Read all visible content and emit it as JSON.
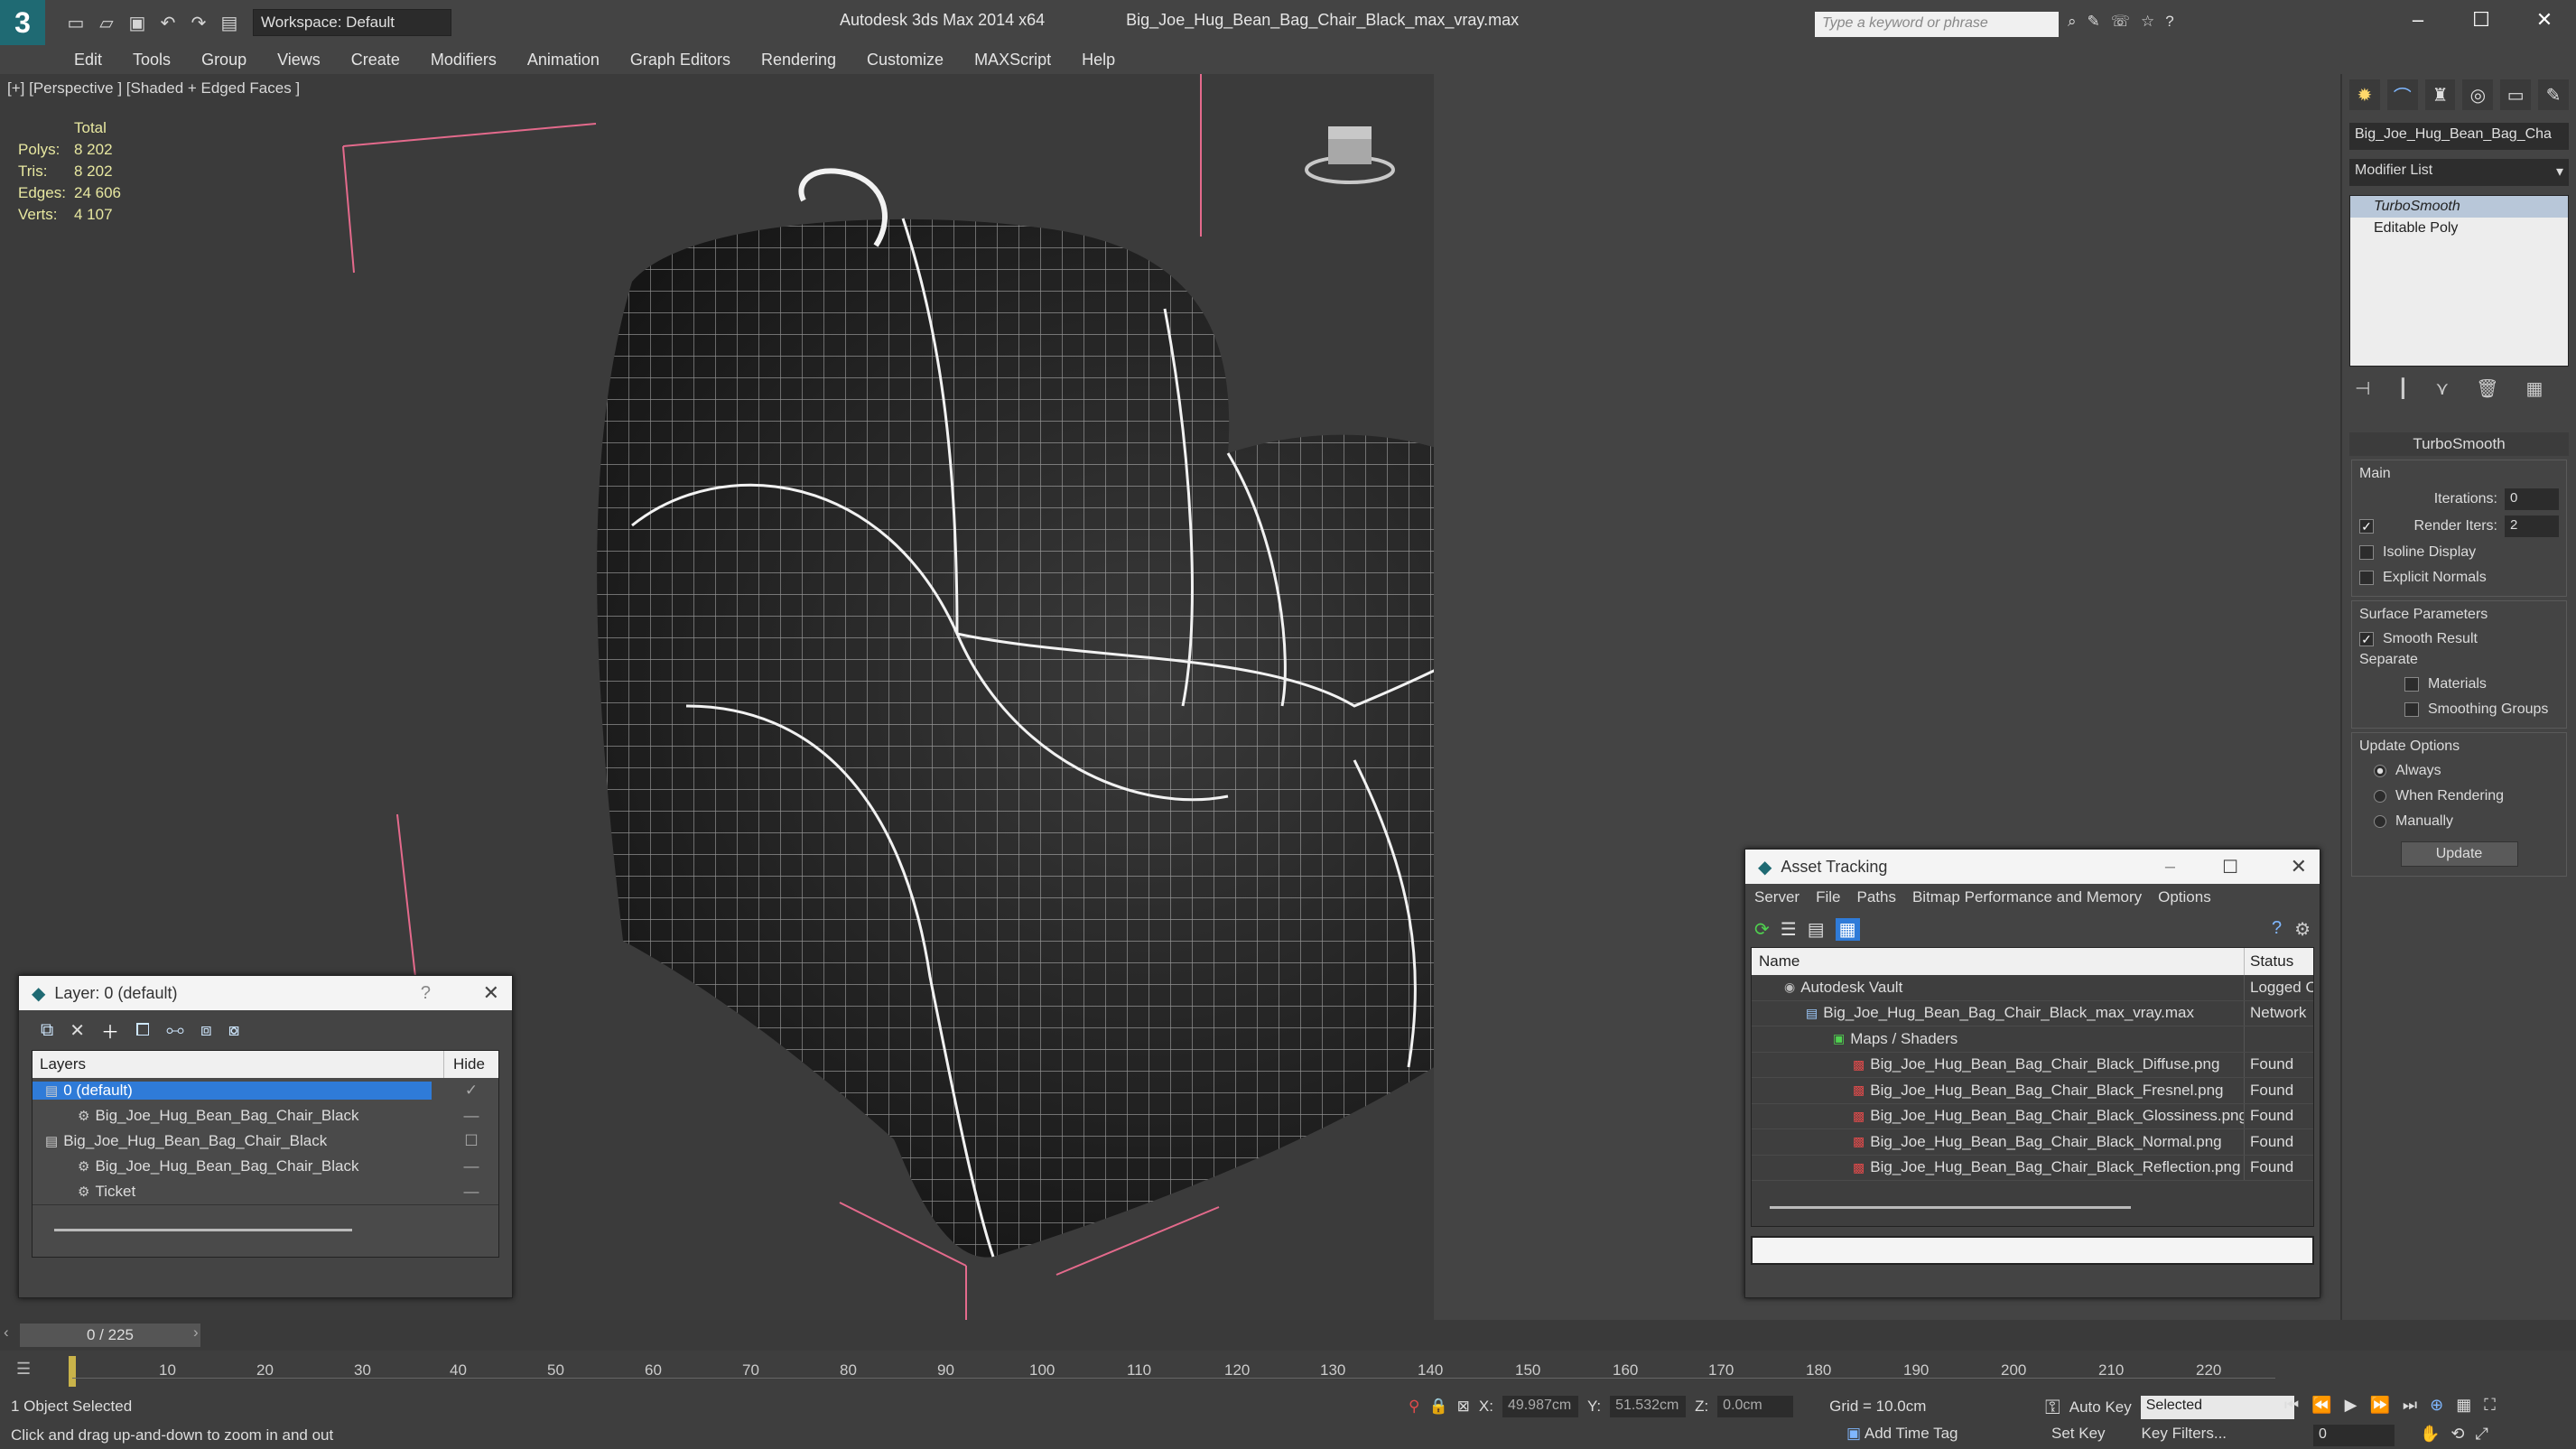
{
  "titlebar": {
    "app": "Autodesk 3ds Max  2014 x64",
    "file": "Big_Joe_Hug_Bean_Bag_Chair_Black_max_vray.max",
    "workspace": "Workspace: Default",
    "search_placeholder": "Type a keyword or phrase"
  },
  "menu": [
    "Edit",
    "Tools",
    "Group",
    "Views",
    "Create",
    "Modifiers",
    "Animation",
    "Graph Editors",
    "Rendering",
    "Customize",
    "MAXScript",
    "Help"
  ],
  "viewport": {
    "label": "[+] [Perspective ] [Shaded + Edged Faces ]",
    "stats": {
      "total_label": "Total",
      "rows": [
        {
          "k": "Polys:",
          "v": "8 202"
        },
        {
          "k": "Tris:",
          "v": "8 202"
        },
        {
          "k": "Edges:",
          "v": "24 606"
        },
        {
          "k": "Verts:",
          "v": "4 107"
        }
      ]
    }
  },
  "command_panel": {
    "object_name": "Big_Joe_Hug_Bean_Bag_Cha",
    "modifier_list": "Modifier List",
    "stack": [
      "TurboSmooth",
      "Editable Poly"
    ],
    "rollout": "TurboSmooth",
    "main_label": "Main",
    "iterations_label": "Iterations:",
    "iterations": "0",
    "render_iters_label": "Render Iters:",
    "render_iters": "2",
    "isoline": "Isoline Display",
    "explicit_normals": "Explicit Normals",
    "surface_label": "Surface Parameters",
    "smooth_result": "Smooth Result",
    "separate_label": "Separate",
    "materials": "Materials",
    "smoothing_groups": "Smoothing Groups",
    "update_options_label": "Update Options",
    "always": "Always",
    "when_rendering": "When Rendering",
    "manually": "Manually",
    "update_btn": "Update"
  },
  "layer_panel": {
    "title": "Layer: 0 (default)",
    "col_layers": "Layers",
    "col_hide": "Hide",
    "rows": [
      {
        "name": "0 (default)",
        "indent": 0,
        "selected": true
      },
      {
        "name": "Big_Joe_Hug_Bean_Bag_Chair_Black",
        "indent": 1,
        "selected": false
      },
      {
        "name": "Big_Joe_Hug_Bean_Bag_Chair_Black",
        "indent": 0,
        "selected": false
      },
      {
        "name": "Big_Joe_Hug_Bean_Bag_Chair_Black",
        "indent": 1,
        "selected": false
      },
      {
        "name": "Ticket",
        "indent": 1,
        "selected": false
      }
    ]
  },
  "asset_panel": {
    "title": "Asset Tracking",
    "menu": [
      "Server",
      "File",
      "Paths",
      "Bitmap Performance and Memory",
      "Options"
    ],
    "col_name": "Name",
    "col_status": "Status",
    "rows": [
      {
        "name": "Autodesk Vault",
        "status": "Logged O",
        "indent": 1,
        "icon": "vault"
      },
      {
        "name": "Big_Joe_Hug_Bean_Bag_Chair_Black_max_vray.max",
        "status": "Network",
        "indent": 2,
        "icon": "file"
      },
      {
        "name": "Maps / Shaders",
        "status": "",
        "indent": 3,
        "icon": "folder"
      },
      {
        "name": "Big_Joe_Hug_Bean_Bag_Chair_Black_Diffuse.png",
        "status": "Found",
        "indent": 4,
        "icon": "png"
      },
      {
        "name": "Big_Joe_Hug_Bean_Bag_Chair_Black_Fresnel.png",
        "status": "Found",
        "indent": 4,
        "icon": "png"
      },
      {
        "name": "Big_Joe_Hug_Bean_Bag_Chair_Black_Glossiness.png",
        "status": "Found",
        "indent": 4,
        "icon": "png"
      },
      {
        "name": "Big_Joe_Hug_Bean_Bag_Chair_Black_Normal.png",
        "status": "Found",
        "indent": 4,
        "icon": "png"
      },
      {
        "name": "Big_Joe_Hug_Bean_Bag_Chair_Black_Reflection.png",
        "status": "Found",
        "indent": 4,
        "icon": "png"
      }
    ]
  },
  "timeline": {
    "frame": "0 / 225",
    "ticks": [
      "10",
      "20",
      "30",
      "40",
      "50",
      "60",
      "70",
      "80",
      "90",
      "100",
      "110",
      "120",
      "130",
      "140",
      "150",
      "160",
      "170",
      "180",
      "190",
      "200",
      "210",
      "220"
    ]
  },
  "status": {
    "selected": "1 Object Selected",
    "prompt": "Click and drag up-and-down to zoom in and out",
    "x": "49.987cm",
    "y": "51.532cm",
    "z": "0.0cm",
    "grid": "Grid = 10.0cm",
    "auto_key": "Auto Key",
    "selected_drop": "Selected",
    "set_key": "Set Key",
    "key_filters": "Key Filters...",
    "add_time_tag": "Add Time Tag",
    "frame_field": "0"
  }
}
